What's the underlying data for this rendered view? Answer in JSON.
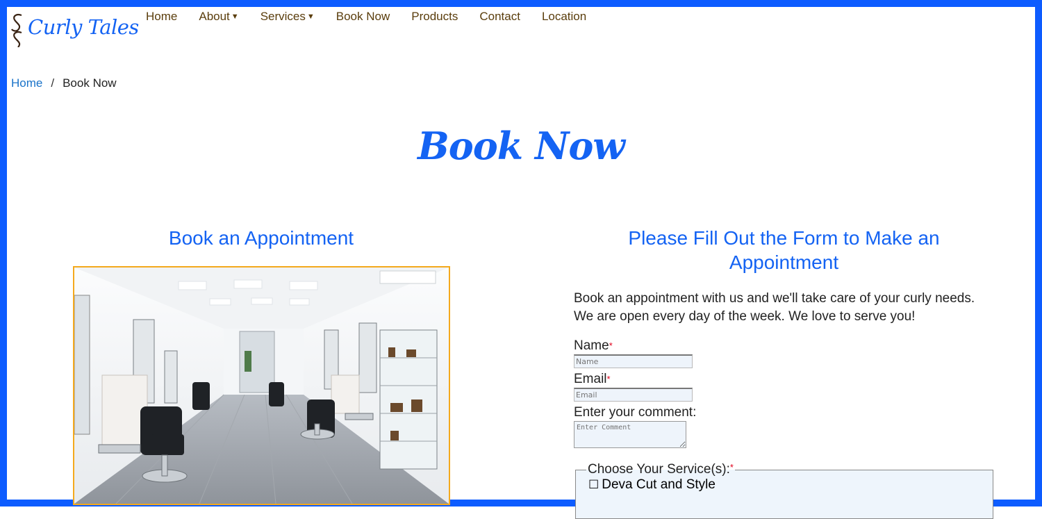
{
  "brand": {
    "name": "Curly Tales"
  },
  "nav": {
    "items": [
      {
        "label": "Home",
        "has_dropdown": false
      },
      {
        "label": "About",
        "has_dropdown": true
      },
      {
        "label": "Services",
        "has_dropdown": true
      },
      {
        "label": "Book Now",
        "has_dropdown": false
      },
      {
        "label": "Products",
        "has_dropdown": false
      },
      {
        "label": "Contact",
        "has_dropdown": false
      },
      {
        "label": "Location",
        "has_dropdown": false
      }
    ]
  },
  "breadcrumb": {
    "home": "Home",
    "separator": "/",
    "current": "Book Now"
  },
  "page": {
    "title": "Book Now"
  },
  "left": {
    "heading": "Book an Appointment"
  },
  "right": {
    "heading": "Please Fill Out the Form to Make an Appointment",
    "intro": "Book an appointment with us and we'll take care of your curly needs. We are open every day of the week. We love to serve you!"
  },
  "form": {
    "required_marker": "*",
    "name_label": "Name",
    "name_placeholder": "Name",
    "email_label": "Email",
    "email_placeholder": "Email",
    "comment_label": "Enter your comment:",
    "comment_placeholder": "Enter Comment",
    "services_legend": "Choose Your Service(s):",
    "services": [
      {
        "label": "Deva Cut and Style",
        "checked": false
      }
    ]
  },
  "colors": {
    "accent": "#1463f3",
    "frame": "#0d5cff",
    "nav_text": "#5a3d0c",
    "link": "#1a73c9",
    "image_border": "#f4a91d",
    "required": "#e0001b"
  }
}
